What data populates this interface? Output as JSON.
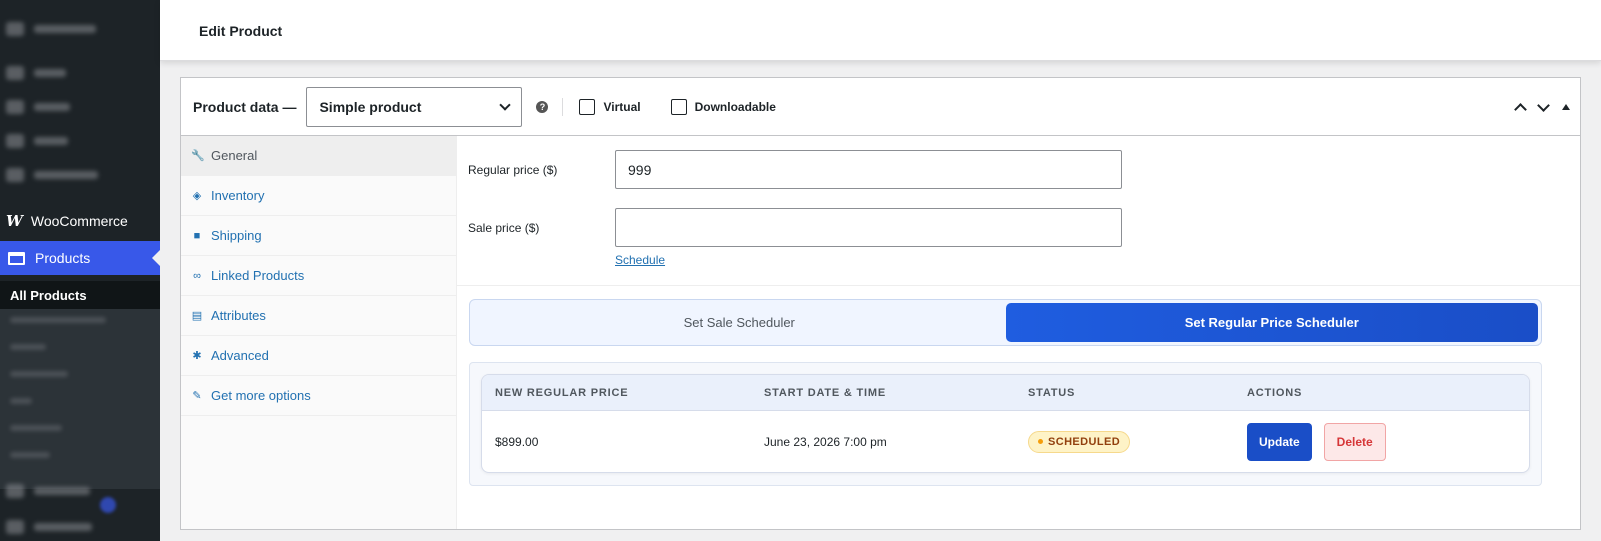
{
  "sidebar": {
    "woocommerce_label": "WooCommerce",
    "woocommerce_glyph": "W",
    "products_label": "Products",
    "all_products_label": "All Products"
  },
  "header": {
    "title": "Edit Product"
  },
  "product_data": {
    "title": "Product data —",
    "type_select": {
      "value": "Simple product"
    },
    "help_glyph": "?",
    "virtual_label": "Virtual",
    "downloadable_label": "Downloadable"
  },
  "tabs": [
    {
      "label": "General",
      "icon": "wrench-icon",
      "glyph": "🔧"
    },
    {
      "label": "Inventory",
      "icon": "tag-icon",
      "glyph": "◈"
    },
    {
      "label": "Shipping",
      "icon": "truck-icon",
      "glyph": "■"
    },
    {
      "label": "Linked Products",
      "icon": "link-icon",
      "glyph": "∞"
    },
    {
      "label": "Attributes",
      "icon": "list-icon",
      "glyph": "▤"
    },
    {
      "label": "Advanced",
      "icon": "gear-icon",
      "glyph": "✱"
    },
    {
      "label": "Get more options",
      "icon": "plugin-icon",
      "glyph": "✎"
    }
  ],
  "general": {
    "regular_price_label": "Regular price ($)",
    "regular_price_value": "999",
    "sale_price_label": "Sale price ($)",
    "sale_price_value": "",
    "schedule_link": "Schedule"
  },
  "scheduler": {
    "options": [
      "Set Sale Scheduler",
      "Set Regular Price Scheduler"
    ],
    "active_option": "Set Regular Price Scheduler",
    "columns": [
      "NEW REGULAR PRICE",
      "START DATE & TIME",
      "STATUS",
      "ACTIONS"
    ],
    "rows": [
      {
        "price": "$899.00",
        "start": "June 23, 2026 7:00 pm",
        "status": "SCHEDULED",
        "update_label": "Update",
        "delete_label": "Delete"
      }
    ]
  },
  "colors": {
    "accent": "#3858e9",
    "primary_button": "#1a4ec7",
    "status_bg": "#fef3c7",
    "delete_text": "#d63638"
  }
}
